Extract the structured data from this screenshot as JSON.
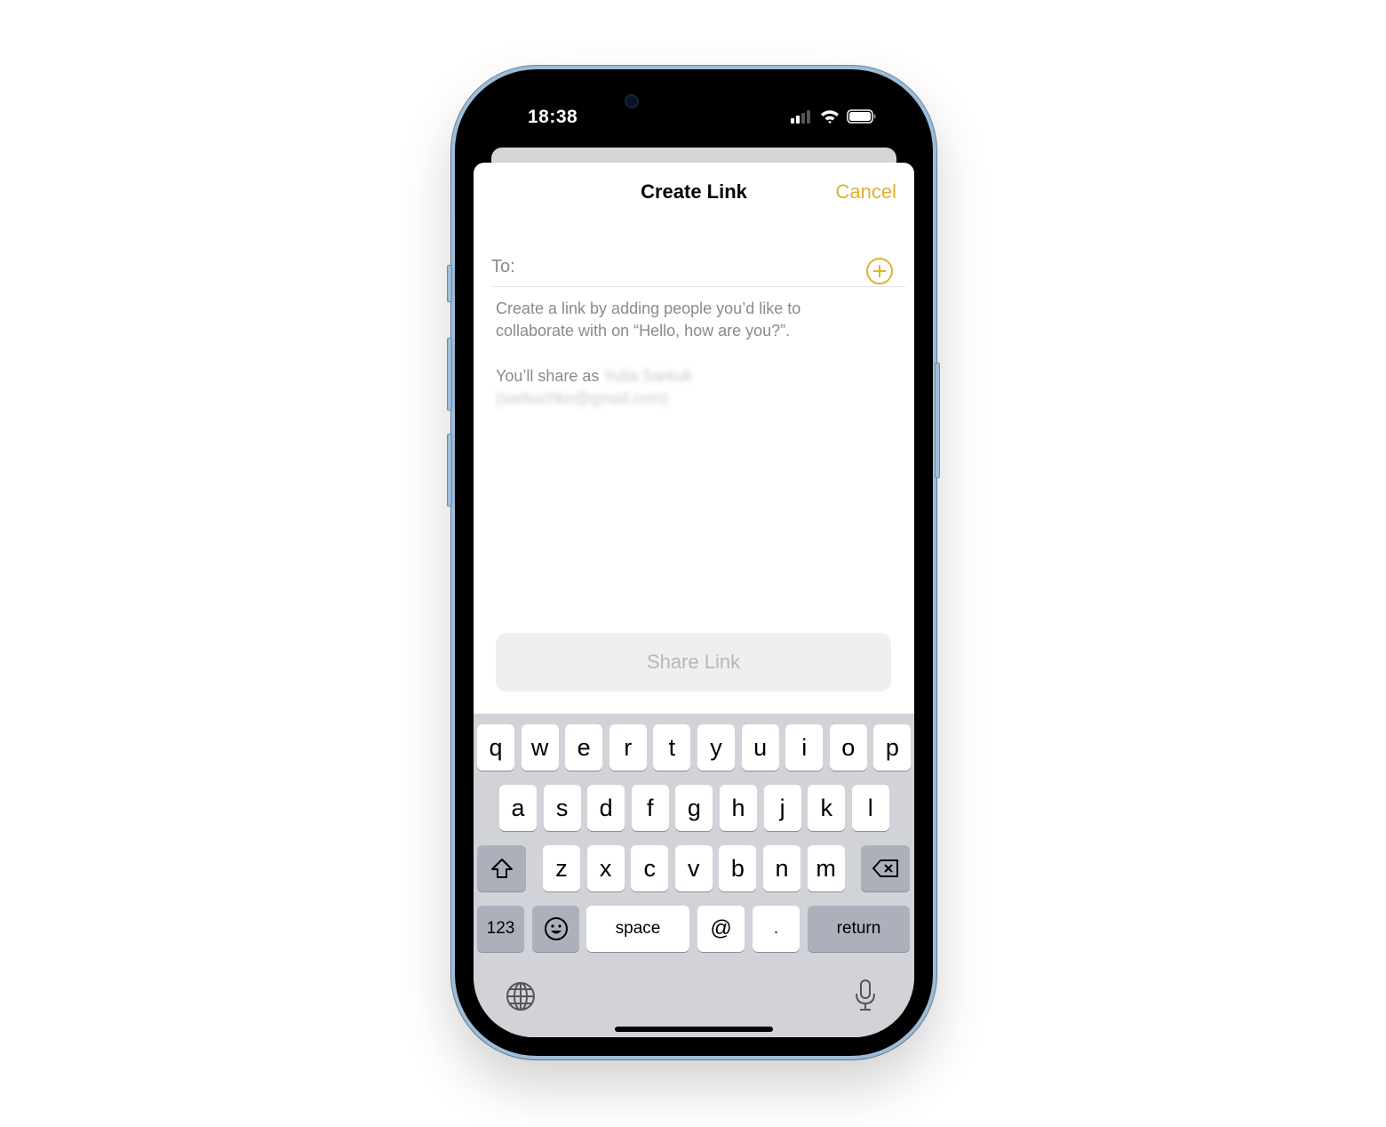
{
  "status_bar": {
    "time": "18:38",
    "icons": [
      "cellular-signal-icon",
      "wifi-icon",
      "battery-icon"
    ]
  },
  "sheet": {
    "title": "Create Link",
    "cancel_label": "Cancel",
    "to_label": "To:",
    "add_icon": "plus-circle-icon",
    "description": "Create a link by adding people you’d like to collaborate with on “Hello, how are you?”.",
    "share_as_prefix": "You’ll share as",
    "share_as_name": "Yulia Sarkuk",
    "share_as_email": "(sarkuchko@gmail.com)",
    "share_button_label": "Share Link"
  },
  "colors": {
    "accent": "#e0b030",
    "secondary_text": "#8a8a8e",
    "disabled_button_bg": "#eeefef",
    "keyboard_bg": "#d1d3d9"
  },
  "keyboard": {
    "row1": [
      "q",
      "w",
      "e",
      "r",
      "t",
      "y",
      "u",
      "i",
      "o",
      "p"
    ],
    "row2": [
      "a",
      "s",
      "d",
      "f",
      "g",
      "h",
      "j",
      "k",
      "l"
    ],
    "row3": [
      "z",
      "x",
      "c",
      "v",
      "b",
      "n",
      "m"
    ],
    "shift_icon": "shift-icon",
    "delete_icon": "delete-backspace-icon",
    "numbers_label": "123",
    "emoji_icon": "emoji-icon",
    "space_label": "space",
    "at_label": "@",
    "dot_label": ".",
    "return_label": "return",
    "globe_icon": "globe-icon",
    "mic_icon": "microphone-icon"
  }
}
